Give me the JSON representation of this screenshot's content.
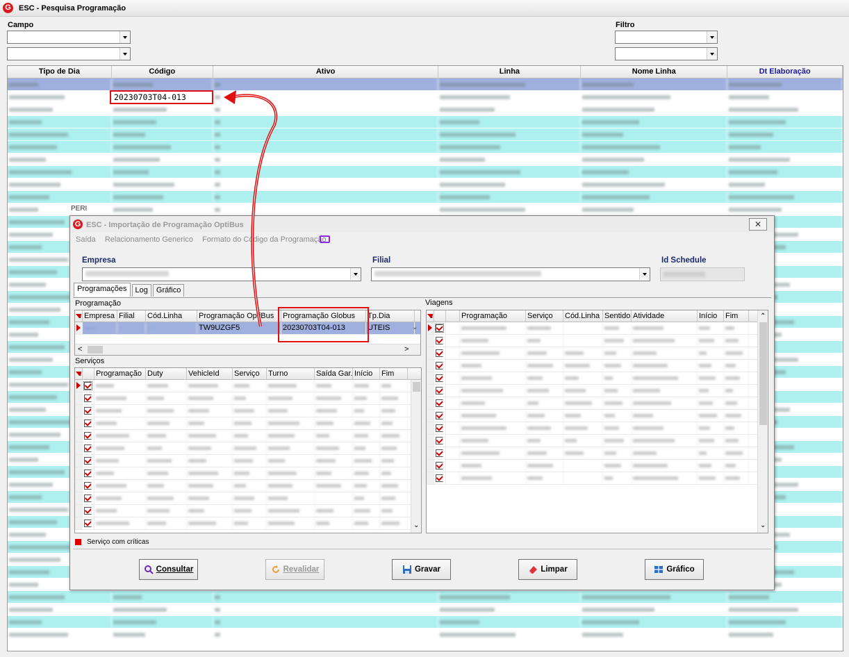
{
  "window": {
    "title": "ESC - Pesquisa Programação"
  },
  "filters": {
    "campo_label": "Campo",
    "filtro_label": "Filtro"
  },
  "main_grid": {
    "columns": [
      "Tipo de Dia",
      "Código",
      "Ativo",
      "Linha",
      "Nome Linha",
      "Dt Elaboração"
    ],
    "highlight_code": "20230703T04-013",
    "overlap_text": "PERI"
  },
  "dialog": {
    "title": "ESC - Importação de Programação OptiBus",
    "menu": [
      "Saída",
      "Relacionamento Generico",
      "Formato do Código da Programação"
    ],
    "empresa_label": "Empresa",
    "filial_label": "Filial",
    "idschedule_label": "Id Schedule",
    "tabs": [
      "Programações",
      "Log",
      "Gráfico"
    ],
    "programacao": {
      "section_label": "Programação",
      "columns": [
        "Empresa",
        "Filial",
        "Cód.Linha",
        "Programação OptiBus",
        "Programação Globus",
        "Tp.Dia"
      ],
      "row": {
        "optibus": "TW9UZGF5",
        "globus": "20230703T04-013",
        "tpdia": "UTEIS"
      }
    },
    "servicos": {
      "section_label": "Serviços",
      "columns": [
        "Programação",
        "Duty",
        "VehicleId",
        "Serviço",
        "Turno",
        "Saída Gar.",
        "Início",
        "Fim"
      ]
    },
    "viagens": {
      "section_label": "Viagens",
      "columns": [
        "Programação",
        "Serviço",
        "Cód.Linha",
        "Sentido",
        "Atividade",
        "Início",
        "Fim"
      ]
    },
    "legend": "Serviço com críticas",
    "buttons": {
      "consultar": "Consultar",
      "revalidar": "Revalidar",
      "gravar": "Gravar",
      "limpar": "Limpar",
      "grafico": "Gráfico"
    }
  }
}
